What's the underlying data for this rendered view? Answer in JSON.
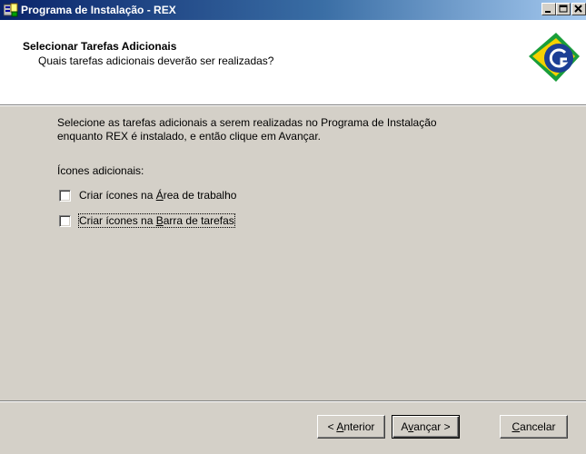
{
  "window": {
    "title": "Programa de Instalação - REX"
  },
  "header": {
    "title": "Selecionar Tarefas Adicionais",
    "subtitle": "Quais tarefas adicionais deverão ser realizadas?",
    "logo_icon": "brazil-government-logo"
  },
  "body": {
    "description_line1": "Selecione as tarefas adicionais a serem realizadas no Programa de Instalação",
    "description_line2": "enquanto REX é instalado, e então clique em Avançar.",
    "section_label": "Ícones adicionais:",
    "tasks": [
      {
        "pre": "Criar ícones na ",
        "accel": "Á",
        "post": "rea de trabalho",
        "checked": false
      },
      {
        "pre": "Criar ícones na ",
        "accel": "B",
        "post": "arra de tarefas",
        "checked": false
      }
    ]
  },
  "buttons": {
    "back": {
      "pre": "< ",
      "accel": "A",
      "post": "nterior"
    },
    "next": {
      "pre": "A",
      "accel": "v",
      "post": "ançar >"
    },
    "cancel": {
      "pre": "",
      "accel": "C",
      "post": "ancelar"
    }
  },
  "colors": {
    "titlebar_start": "#0a246a",
    "titlebar_end": "#a6caf0",
    "face": "#d4d0c8",
    "logo_green": "#1a9e3a",
    "logo_yellow": "#f5d100",
    "logo_blue": "#1c3f95"
  }
}
